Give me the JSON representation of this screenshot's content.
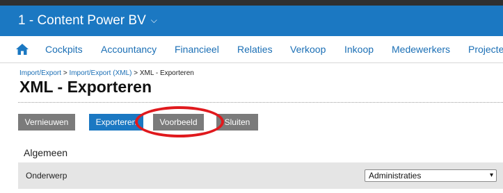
{
  "header": {
    "company": "1 - Content Power BV",
    "caret": "⌵"
  },
  "nav": {
    "home_icon": "home-icon",
    "items": [
      "Cockpits",
      "Accountancy",
      "Financieel",
      "Relaties",
      "Verkoop",
      "Inkoop",
      "Medewerkers",
      "Projecten"
    ]
  },
  "breadcrumb": {
    "items": [
      "Import/Export",
      "Import/Export (XML)",
      "XML - Exporteren"
    ],
    "separator": ">"
  },
  "page": {
    "title": "XML - Exporteren"
  },
  "toolbar": {
    "refresh": "Vernieuwen",
    "export": "Exporteren",
    "preview": "Voorbeeld",
    "close": "Sluiten"
  },
  "form": {
    "section": "Algemeen",
    "subject_label": "Onderwerp",
    "subject_value": "Administraties"
  },
  "colors": {
    "brand": "#1b78c2",
    "highlight_ring": "#e0191d",
    "button_grey": "#7b7b7b"
  }
}
